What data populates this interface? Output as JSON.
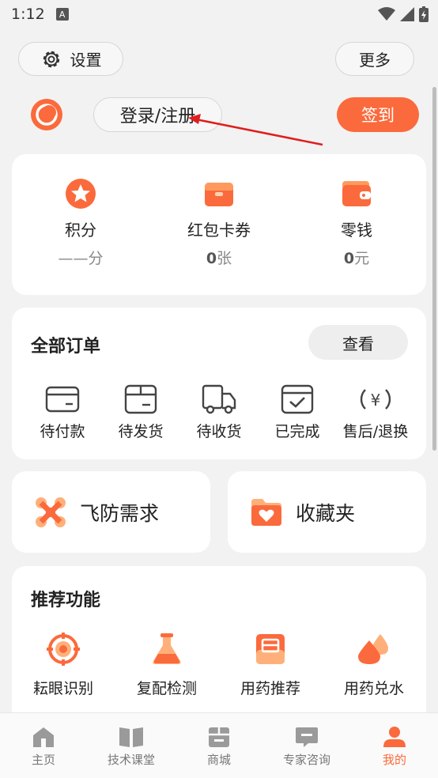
{
  "status_bar": {
    "time": "1:12",
    "notification_icon": "A"
  },
  "header": {
    "settings_label": "设置",
    "more_label": "更多",
    "login_label": "登录/注册",
    "signin_label": "签到"
  },
  "assets": [
    {
      "label": "积分",
      "value_prefix": "",
      "value_bold": "",
      "value_text": "——分",
      "icon": "star-icon"
    },
    {
      "label": "红包卡券",
      "value_bold": "0",
      "value_text": "张",
      "icon": "coupon-icon"
    },
    {
      "label": "零钱",
      "value_bold": "0",
      "value_text": "元",
      "icon": "wallet-icon"
    }
  ],
  "orders": {
    "title": "全部订单",
    "view_label": "查看",
    "items": [
      {
        "label": "待付款",
        "icon": "card-icon"
      },
      {
        "label": "待发货",
        "icon": "box-icon"
      },
      {
        "label": "待收货",
        "icon": "truck-icon"
      },
      {
        "label": "已完成",
        "icon": "check-box-icon"
      },
      {
        "label": "售后/退换",
        "icon": "refund-icon"
      }
    ]
  },
  "quick": {
    "fangfei_label": "飞防需求",
    "favorites_label": "收藏夹"
  },
  "recommend": {
    "title": "推荐功能",
    "items": [
      {
        "label": "耘眼识别",
        "icon": "target-icon"
      },
      {
        "label": "复配检测",
        "icon": "flask-icon"
      },
      {
        "label": "用药推荐",
        "icon": "document-icon"
      },
      {
        "label": "用药兑水",
        "icon": "water-drops-icon"
      }
    ]
  },
  "tabs": [
    {
      "label": "主页",
      "icon": "home-icon",
      "active": false
    },
    {
      "label": "技术课堂",
      "icon": "book-icon",
      "active": false
    },
    {
      "label": "商城",
      "icon": "shop-icon",
      "active": false
    },
    {
      "label": "专家咨询",
      "icon": "chat-icon",
      "active": false
    },
    {
      "label": "我的",
      "icon": "user-icon",
      "active": true
    }
  ],
  "colors": {
    "accent": "#fb6a3c",
    "accent_light": "#ffb07a"
  }
}
